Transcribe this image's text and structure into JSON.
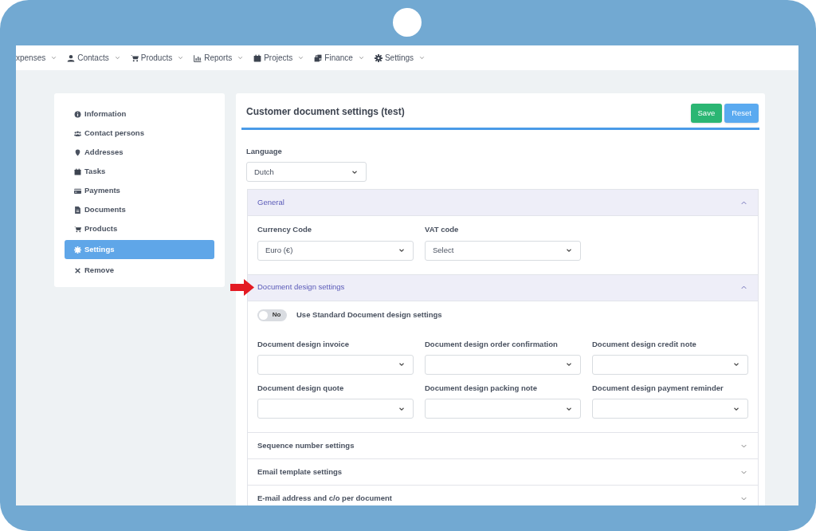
{
  "nav": [
    {
      "label": "xpenses"
    },
    {
      "label": "Contacts"
    },
    {
      "label": "Products"
    },
    {
      "label": "Reports"
    },
    {
      "label": "Projects"
    },
    {
      "label": "Finance"
    },
    {
      "label": "Settings"
    }
  ],
  "sidebar": {
    "items": [
      {
        "label": "Information",
        "selected": false
      },
      {
        "label": "Contact persons",
        "selected": false
      },
      {
        "label": "Addresses",
        "selected": false
      },
      {
        "label": "Tasks",
        "selected": false
      },
      {
        "label": "Payments",
        "selected": false
      },
      {
        "label": "Documents",
        "selected": false
      },
      {
        "label": "Products",
        "selected": false
      },
      {
        "label": "Settings",
        "selected": true
      },
      {
        "label": "Remove",
        "selected": false
      }
    ]
  },
  "panel": {
    "title": "Customer document settings (test)",
    "buttons": [
      {
        "label": "Save",
        "kind": "save"
      },
      {
        "label": "Reset",
        "kind": "reset"
      }
    ],
    "language": {
      "label": "Language",
      "value": "Dutch"
    },
    "sections": [
      {
        "title": "General",
        "expanded": true,
        "fields": [
          {
            "label": "Currency Code",
            "value": "Euro (€)"
          },
          {
            "label": "VAT code",
            "value": "Select"
          }
        ]
      },
      {
        "title": "Document design settings",
        "expanded": true,
        "toggle": {
          "label": "Use Standard Document design settings",
          "on": false,
          "text": "No"
        },
        "fields": [
          {
            "label": "Document design invoice"
          },
          {
            "label": "Document design order confirmation"
          },
          {
            "label": "Document design credit note"
          },
          {
            "label": "Document design quote"
          },
          {
            "label": "Document design packing note"
          },
          {
            "label": "Document design payment reminder"
          }
        ]
      },
      {
        "title": "Sequence number settings",
        "expanded": false
      },
      {
        "title": "Email template settings",
        "expanded": false
      },
      {
        "title": "E-mail address and c/o per document",
        "expanded": false
      }
    ]
  }
}
